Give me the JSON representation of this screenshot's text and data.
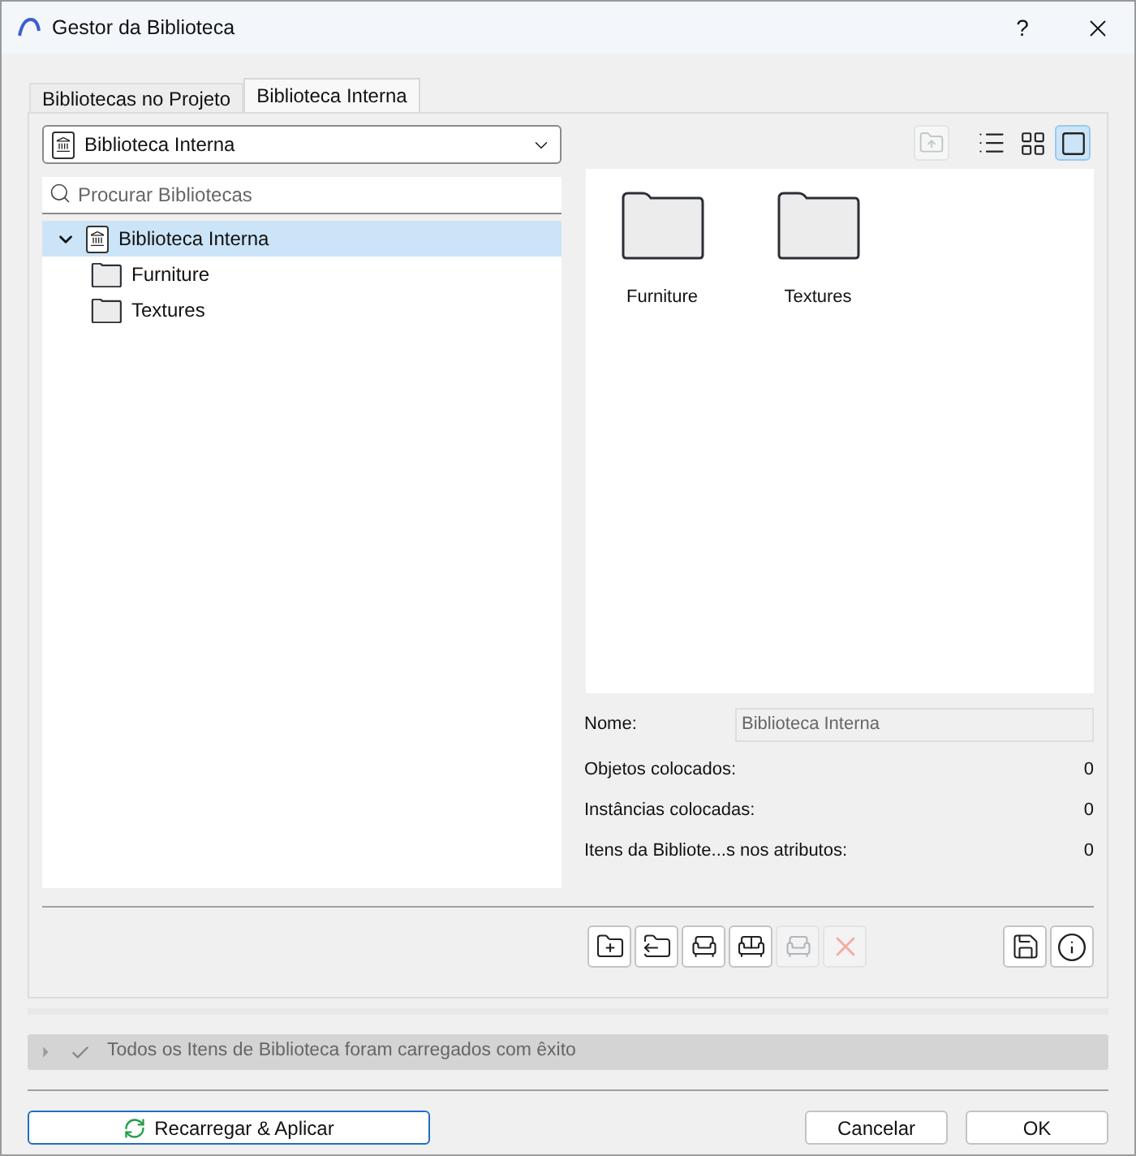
{
  "window": {
    "title": "Gestor da Biblioteca",
    "help": "?"
  },
  "tabs": [
    {
      "label": "Bibliotecas no Projeto",
      "selected": false
    },
    {
      "label": "Biblioteca Interna",
      "selected": true
    }
  ],
  "library_select": {
    "value": "Biblioteca Interna"
  },
  "view_buttons": [
    {
      "kind": "up",
      "selected": false,
      "disabled": true
    },
    {
      "kind": "list",
      "selected": false,
      "disabled": false
    },
    {
      "kind": "grid",
      "selected": false,
      "disabled": false
    },
    {
      "kind": "single",
      "selected": true,
      "disabled": false
    }
  ],
  "search": {
    "placeholder": "Procurar Bibliotecas"
  },
  "tree": [
    {
      "label": "Biblioteca Interna",
      "expanded": true,
      "selected": true,
      "children": [
        {
          "label": "Furniture",
          "selected": false
        },
        {
          "label": "Textures",
          "selected": false
        }
      ]
    }
  ],
  "folders": [
    {
      "label": "Furniture"
    },
    {
      "label": "Textures"
    }
  ],
  "name_field": {
    "label": "Nome:",
    "value": "Biblioteca Interna"
  },
  "stats": [
    {
      "label": "Objetos colocados:",
      "value": "0"
    },
    {
      "label": "Instâncias colocadas:",
      "value": "0"
    },
    {
      "label": "Itens da Bibliote...s nos atributos:",
      "value": "0"
    }
  ],
  "tool_buttons": [
    {
      "kind": "addfolder",
      "disabled": false
    },
    {
      "kind": "exportfolder",
      "disabled": false
    },
    {
      "kind": "chairup",
      "disabled": false
    },
    {
      "kind": "chairs",
      "disabled": false
    },
    {
      "kind": "chairmove",
      "disabled": true
    },
    {
      "kind": "delete",
      "disabled": true
    }
  ],
  "side_buttons": [
    {
      "kind": "save",
      "disabled": false
    },
    {
      "kind": "info",
      "disabled": false
    }
  ],
  "status": {
    "message": "Todos os Itens de Biblioteca foram carregados com êxito",
    "expanded": false
  },
  "buttons": [
    {
      "kind": "reload",
      "label": "Recarregar & Aplicar"
    },
    {
      "kind": "cancel",
      "label": "Cancelar"
    },
    {
      "kind": "ok",
      "label": "OK"
    }
  ]
}
